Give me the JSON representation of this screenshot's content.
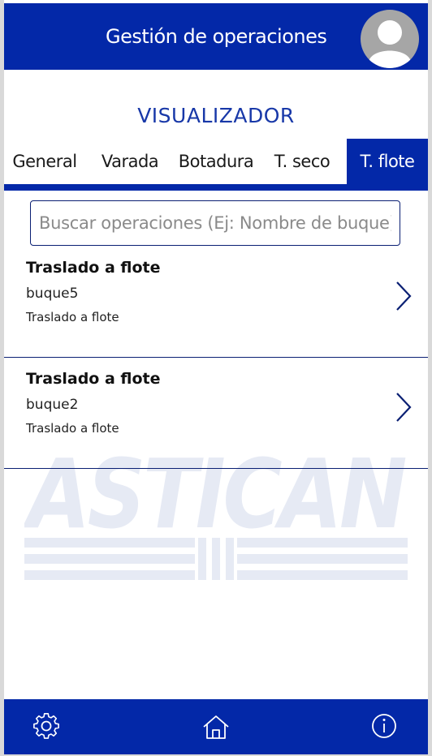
{
  "header": {
    "title": "Gestión de operaciones"
  },
  "viewer": {
    "title": "VISUALIZADOR"
  },
  "tabs": [
    {
      "label": "General",
      "active": false
    },
    {
      "label": "Varada",
      "active": false
    },
    {
      "label": "Botadura",
      "active": false
    },
    {
      "label": "T. seco",
      "active": false
    },
    {
      "label": "T. flote",
      "active": true
    }
  ],
  "search": {
    "placeholder": "Buscar operaciones (Ej: Nombre de buque)",
    "value": ""
  },
  "items": [
    {
      "title": "Traslado a flote",
      "subtitle": "buque5",
      "description": "Traslado a flote"
    },
    {
      "title": "Traslado a flote",
      "subtitle": "buque2",
      "description": "Traslado a flote"
    }
  ],
  "watermark": {
    "text": "ASTICAN"
  },
  "footer": {
    "icons": [
      "settings-gear-icon",
      "home-icon",
      "info-icon"
    ]
  },
  "colors": {
    "brand": "#0328a8",
    "page_bg": "#ffffff",
    "outer_bg": "#d9d9d9"
  }
}
